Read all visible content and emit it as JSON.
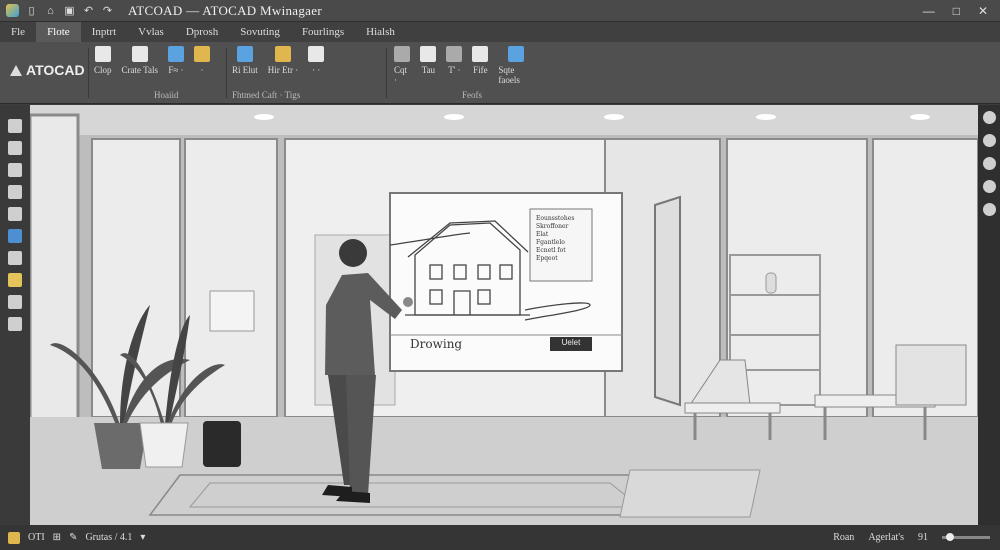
{
  "window": {
    "title": "ATCOAD — ATOCAD Mwinagaer",
    "controls": [
      "—",
      "□",
      "✕"
    ]
  },
  "quick_access": [
    "logo-icon",
    "new-icon",
    "open-icon",
    "save-icon",
    "undo-icon",
    "redo-icon"
  ],
  "menu": {
    "tabs": [
      "Fle",
      "Flote",
      "Inptrt",
      "Vvlas",
      "Dprosh",
      "Sovuting",
      "Fourlings",
      "Hialsh"
    ],
    "active_index": 1
  },
  "ribbon": {
    "brand": "ATOCAD",
    "group1": {
      "items": [
        "Clop",
        "Crate Tals",
        "F≈ ·",
        "· "
      ],
      "label": "Hoaiid"
    },
    "group2": {
      "items": [
        "Ri Elut",
        "Hir Etr ·",
        "· ·"
      ],
      "label": "Fhtmed Caft · Tigs"
    },
    "group3": {
      "items": [
        "Cqt ·",
        "Tau",
        "T' ·",
        "Fife",
        "Sqte faoels"
      ],
      "label": "Feofs"
    }
  },
  "canvas": {
    "board": {
      "caption": "Drowing",
      "button": "Uelet",
      "list_title": "Eounsstohes",
      "list_items": [
        "Skroffoner",
        "Elat",
        "Fgantlelo",
        "Ecnetl fot",
        "Epqeot"
      ]
    }
  },
  "status": {
    "left": [
      "OTI",
      "Grutas / 4.1"
    ],
    "right": [
      "Roan",
      "Agerlat's",
      "91"
    ],
    "zoom_fraction": 0.1
  }
}
